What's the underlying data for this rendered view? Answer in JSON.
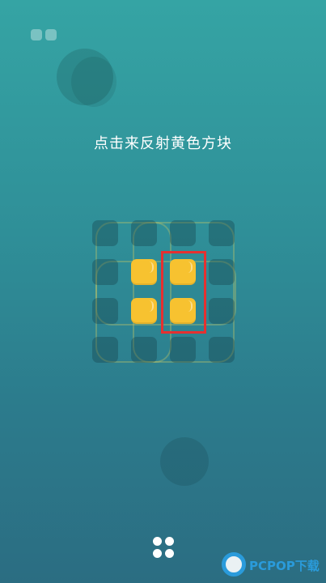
{
  "game": {
    "instruction": "点击来反射黄色方块",
    "grid": {
      "rows": 4,
      "cols": 4,
      "yellow_tiles": [
        [
          1,
          1
        ],
        [
          1,
          2
        ],
        [
          2,
          1
        ],
        [
          2,
          2
        ]
      ]
    },
    "highlight_column": 2
  },
  "icons": {
    "pause": "pause-icon",
    "menu": "grid-menu-icon"
  },
  "colors": {
    "tile_yellow": "#f7c230",
    "highlight": "#e53030",
    "bg_top": "#35a4a4",
    "bg_bottom": "#2b6d82"
  },
  "watermark": {
    "brand": "PCPOP",
    "suffix": "下载"
  }
}
